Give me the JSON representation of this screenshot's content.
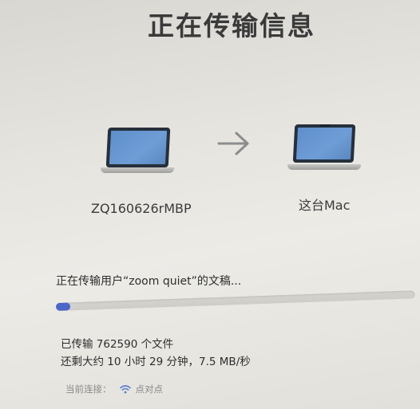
{
  "window": {
    "title": "正在传输信息"
  },
  "devices": {
    "source": {
      "label": "ZQ160626rMBP",
      "icon": "laptop-icon"
    },
    "target": {
      "label": "这台Mac",
      "icon": "laptop-icon"
    },
    "arrow_icon": "arrow-right-icon"
  },
  "progress": {
    "status_text": "正在传输用户“zoom quiet”的文稿...",
    "fraction": 0.04,
    "color": "#4a67c9"
  },
  "details": {
    "files_text": "已传输 762590 个文件",
    "remaining_text": "还剩大约 10 小时 29 分钟，7.5 MB/秒"
  },
  "connection": {
    "label": "当前连接：",
    "network": "点对点",
    "icon": "wifi-icon"
  }
}
